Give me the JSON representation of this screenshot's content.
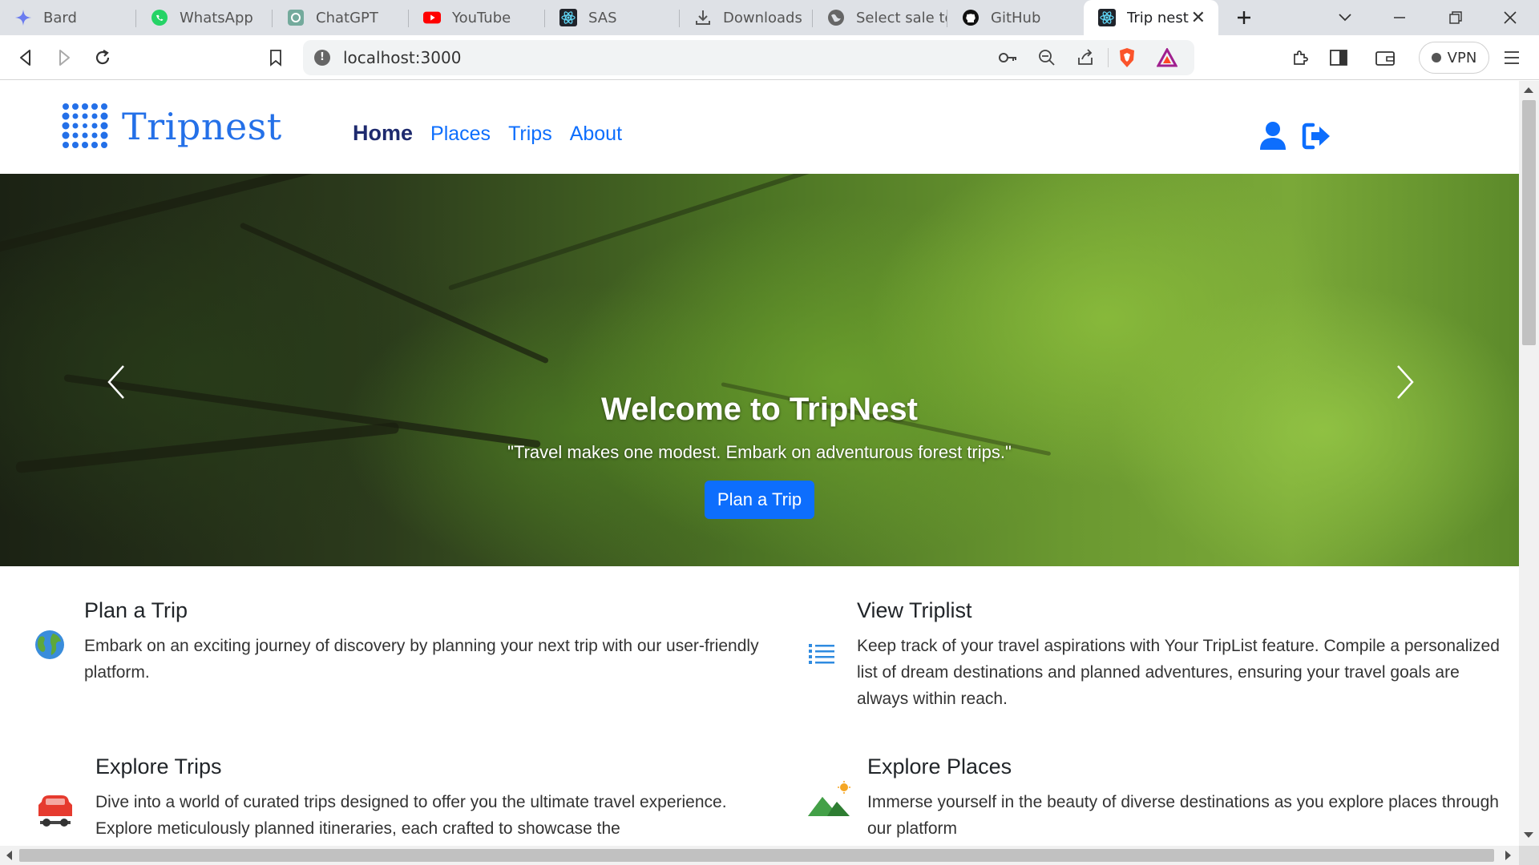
{
  "browser": {
    "tabs": [
      {
        "label": "Bard",
        "icon": "bard-sparkle-icon"
      },
      {
        "label": "WhatsApp",
        "icon": "whatsapp-icon"
      },
      {
        "label": "ChatGPT",
        "icon": "chatgpt-icon"
      },
      {
        "label": "YouTube",
        "icon": "youtube-icon"
      },
      {
        "label": "SAS",
        "icon": "react-icon"
      },
      {
        "label": "Downloads",
        "icon": "download-icon"
      },
      {
        "label": "Select sale to",
        "icon": "globe-icon"
      },
      {
        "label": "GitHub",
        "icon": "github-icon"
      },
      {
        "label": "Trip nest",
        "icon": "react-icon",
        "active": true
      }
    ],
    "url": "localhost:3000",
    "vpn_label": "VPN"
  },
  "site": {
    "brand": "Tripnest",
    "brand_color": "#2470e8",
    "nav": [
      {
        "label": "Home",
        "active": true
      },
      {
        "label": "Places"
      },
      {
        "label": "Trips"
      },
      {
        "label": "About"
      }
    ],
    "hero": {
      "title": "Welcome to TripNest",
      "quote": "\"Travel makes one modest. Embark on adventurous forest trips.\"",
      "button": "Plan a Trip",
      "slides": 4,
      "active_slide": 1
    },
    "features": [
      {
        "title": "Plan a Trip",
        "desc": "Embark on an exciting journey of discovery by planning your next trip with our user-friendly platform.",
        "icon": "earth-globe-icon"
      },
      {
        "title": "View Triplist",
        "desc": "Keep track of your travel aspirations with Your TripList feature. Compile a personalized list of dream destinations and planned adventures, ensuring your travel goals are always within reach.",
        "icon": "list-icon"
      },
      {
        "title": "Explore Trips",
        "desc": "Dive into a world of curated trips designed to offer you the ultimate travel experience. Explore meticulously planned itineraries, each crafted to showcase the",
        "icon": "car-icon"
      },
      {
        "title": "Explore Places",
        "desc": "Immerse yourself in the beauty of diverse destinations as you explore places through our platform",
        "icon": "mountain-sun-icon"
      }
    ]
  }
}
